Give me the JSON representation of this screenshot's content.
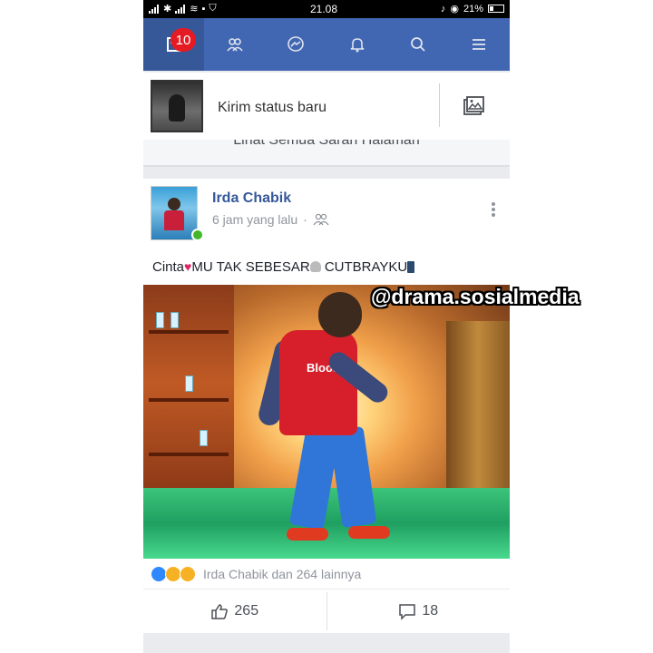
{
  "status_bar": {
    "time": "21.08",
    "battery": "21%"
  },
  "nav": {
    "items": [
      {
        "icon": "news-feed-icon",
        "badge": "10"
      },
      {
        "icon": "friends-icon"
      },
      {
        "icon": "messenger-icon"
      },
      {
        "icon": "notifications-bell-icon"
      },
      {
        "icon": "search-icon"
      },
      {
        "icon": "menu-icon"
      }
    ],
    "active_color": "#365899",
    "bar_color": "#4267b2",
    "badge_color": "#e41b23"
  },
  "composer": {
    "placeholder": "Kirim status baru",
    "photo_icon": "photo-icon"
  },
  "suggestion": {
    "link_text": "Lihat Semua Saran Halaman"
  },
  "post": {
    "author": "Irda Chabik",
    "time": "6 jam yang lalu",
    "audience_icon": "friends-audience-icon",
    "caption_part1": "Cinta",
    "caption_part2": "MU TAK SEBESAR",
    "caption_part3": " CUTBRAYKU",
    "photo_shirt_text": "Bloos",
    "reactions": {
      "types": [
        "like",
        "haha",
        "wow"
      ],
      "text": "Irda Chabik dan 264 lainnya"
    },
    "actions": {
      "like_count": "265",
      "comment_count": "18"
    }
  },
  "watermark": "@drama.sosialmedia"
}
